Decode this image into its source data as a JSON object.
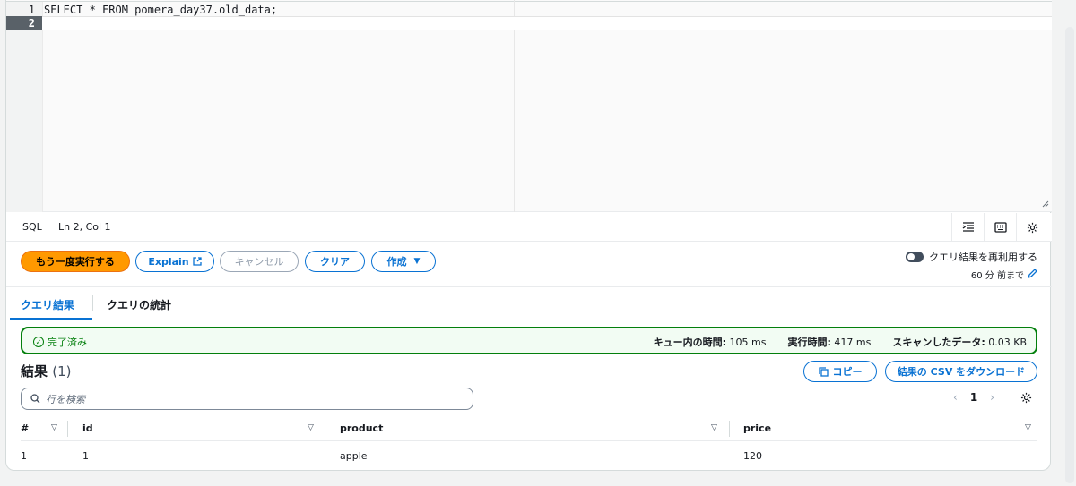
{
  "editor": {
    "lines": [
      {
        "number": "1",
        "code": "SELECT * FROM pomera_day37.old_data;"
      },
      {
        "number": "2",
        "code": ""
      }
    ]
  },
  "statusbar": {
    "language": "SQL",
    "position": "Ln 2, Col 1",
    "icons": [
      "format-icon",
      "keyboard-icon",
      "settings-icon"
    ]
  },
  "actions": {
    "run_again": "もう一度実行する",
    "explain": "Explain",
    "cancel": "キャンセル",
    "clear": "クリア",
    "create": "作成",
    "reuse_label": "クエリ結果を再利用する",
    "reuse_age": "60 分 前まで",
    "reuse_enabled": false
  },
  "tabs": [
    {
      "label": "クエリ結果",
      "active": true
    },
    {
      "label": "クエリの統計",
      "active": false
    }
  ],
  "status": {
    "state": "完了済み",
    "queue_time_label": "キュー内の時間:",
    "queue_time": "105 ms",
    "run_time_label": "実行時間:",
    "run_time": "417 ms",
    "scanned_label": "スキャンしたデータ:",
    "scanned": "0.03 KB",
    "color": "#037f0c"
  },
  "results": {
    "title": "結果",
    "count": "(1)",
    "copy": "コピー",
    "download_csv": "結果の CSV をダウンロード",
    "search_placeholder": "行を検索",
    "page": "1",
    "columns": [
      "#",
      "id",
      "product",
      "price"
    ],
    "rows": [
      [
        "1",
        "1",
        "apple",
        "120"
      ]
    ]
  },
  "colors": {
    "primary": "#ff9900",
    "accent": "#0972d3"
  }
}
